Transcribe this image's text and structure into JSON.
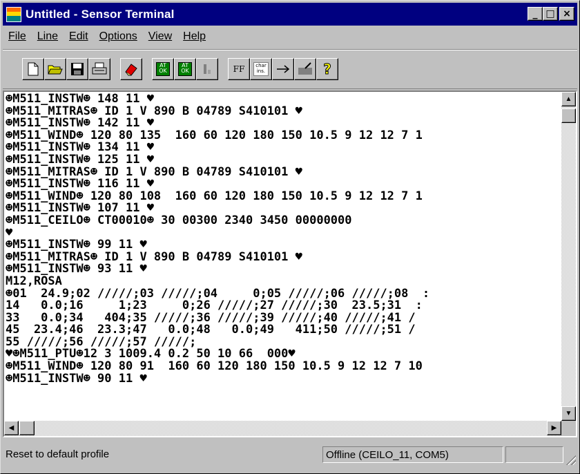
{
  "window": {
    "title": "Untitled - Sensor Terminal",
    "controls": {
      "minimize": "_",
      "maximize": "□",
      "close": "×"
    }
  },
  "menu": [
    {
      "label": "File",
      "name": "menu-file"
    },
    {
      "label": "Line",
      "name": "menu-line"
    },
    {
      "label": "Edit",
      "name": "menu-edit"
    },
    {
      "label": "Options",
      "name": "menu-options"
    },
    {
      "label": "View",
      "name": "menu-view"
    },
    {
      "label": "Help",
      "name": "menu-help"
    }
  ],
  "toolbar": {
    "buttons": [
      {
        "icon": "new-document-icon"
      },
      {
        "icon": "open-folder-icon"
      },
      {
        "icon": "save-icon"
      },
      {
        "icon": "print-icon"
      },
      {
        "icon": "eraser-icon"
      },
      {
        "icon": "at-ok-icon",
        "text": "AT OK"
      },
      {
        "icon": "at-ok-send-icon",
        "text": "AT OK"
      },
      {
        "icon": "disabled-cursor-icon"
      },
      {
        "icon": "formfeed-icon",
        "text": "FF"
      },
      {
        "icon": "char-ins-icon",
        "text": "char ins."
      },
      {
        "icon": "arrow-right-icon"
      },
      {
        "icon": "transfer-icon"
      },
      {
        "icon": "help-question-icon"
      }
    ]
  },
  "terminal": {
    "lines": [
      "☻M511_INSTW☻ 148 11 ♥",
      "☻M511_MITRAS☻ ID 1 V 890 B 04789 S410101 ♥",
      "☻M511_INSTW☻ 142 11 ♥",
      "☻M511_WIND☻ 120 80 135  160 60 120 180 150 10.5 9 12 12 7 1",
      "☻M511_INSTW☻ 134 11 ♥",
      "☻M511_INSTW☻ 125 11 ♥",
      "☻M511_MITRAS☻ ID 1 V 890 B 04789 S410101 ♥",
      "☻M511_INSTW☻ 116 11 ♥",
      "☻M511_WIND☻ 120 80 108  160 60 120 180 150 10.5 9 12 12 7 1",
      "☻M511_INSTW☻ 107 11 ♥",
      "☻M511_CEILO☻ CT00010☻ 30 00300 2340 3450 00000000",
      "♥",
      "☻M511_INSTW☻ 99 11 ♥",
      "☻M511_MITRAS☻ ID 1 V 890 B 04789 S410101 ♥",
      "☻M511_INSTW☻ 93 11 ♥",
      "M12,ROSA",
      "☻01  24.9;02 /////;03 /////;04     0;05 /////;06 /////;08  :",
      "14   0.0;16     1;23     0;26 /////;27 /////;30  23.5;31  :",
      "33   0.0;34   404;35 /////;36 /////;39 /////;40 /////;41 /",
      "45  23.4;46  23.3;47   0.0;48   0.0;49   411;50 /////;51 /",
      "55 /////;56 /////;57 /////;",
      "♥☻M511_PTU☻12 3 1009.4 0.2 50 10 66  000♥",
      "☻M511_WIND☻ 120 80 91  160 60 120 180 150 10.5 9 12 12 7 10",
      "☻M511_INSTW☻ 90 11 ♥"
    ]
  },
  "statusbar": {
    "message": "Reset to default profile",
    "connection": "Offline (CEILO_11, COM5)",
    "extra": ""
  },
  "scrollbars": {
    "up_arrow": "▲",
    "down_arrow": "▼",
    "left_arrow": "◀",
    "right_arrow": "▶"
  }
}
